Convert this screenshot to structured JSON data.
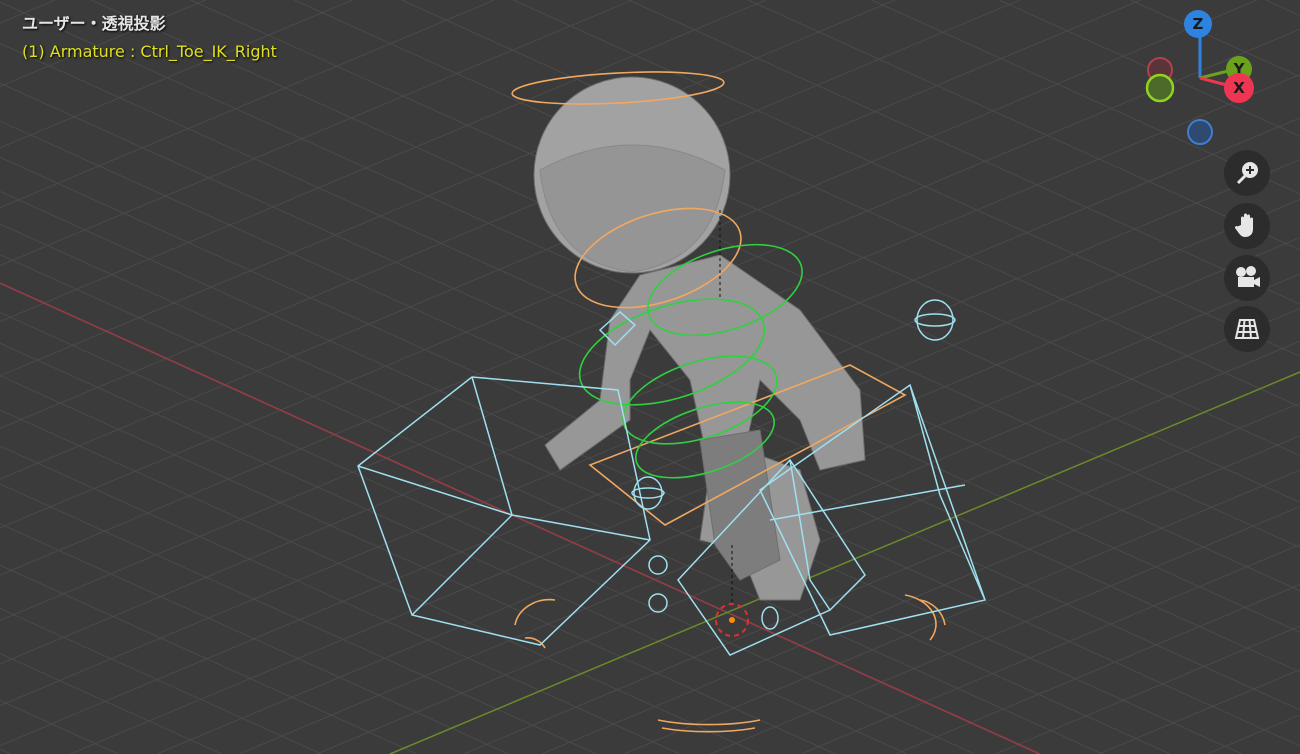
{
  "viewport": {
    "view_name": "ユーザー・透視投影",
    "active_object": "(1) Armature : Ctrl_Toe_IK_Right"
  },
  "gizmo": {
    "axes": [
      {
        "label": "Z",
        "color": "#2f83e0"
      },
      {
        "label": "Y",
        "color": "#6aa21c"
      },
      {
        "label": "X",
        "color": "#ee3552"
      }
    ]
  },
  "nav_buttons": [
    {
      "icon": "zoom-icon"
    },
    {
      "icon": "hand-pan-icon"
    },
    {
      "icon": "camera-icon"
    },
    {
      "icon": "grid-ortho-icon"
    }
  ],
  "colors": {
    "background": "#3b3b3b",
    "grid": "#4a4a4a",
    "x_axis": "#9a3a44",
    "y_axis": "#6a8a2a",
    "bone_selected": "#9fe0f0",
    "bone_orange": "#f0a860",
    "bone_green": "#30d040"
  }
}
